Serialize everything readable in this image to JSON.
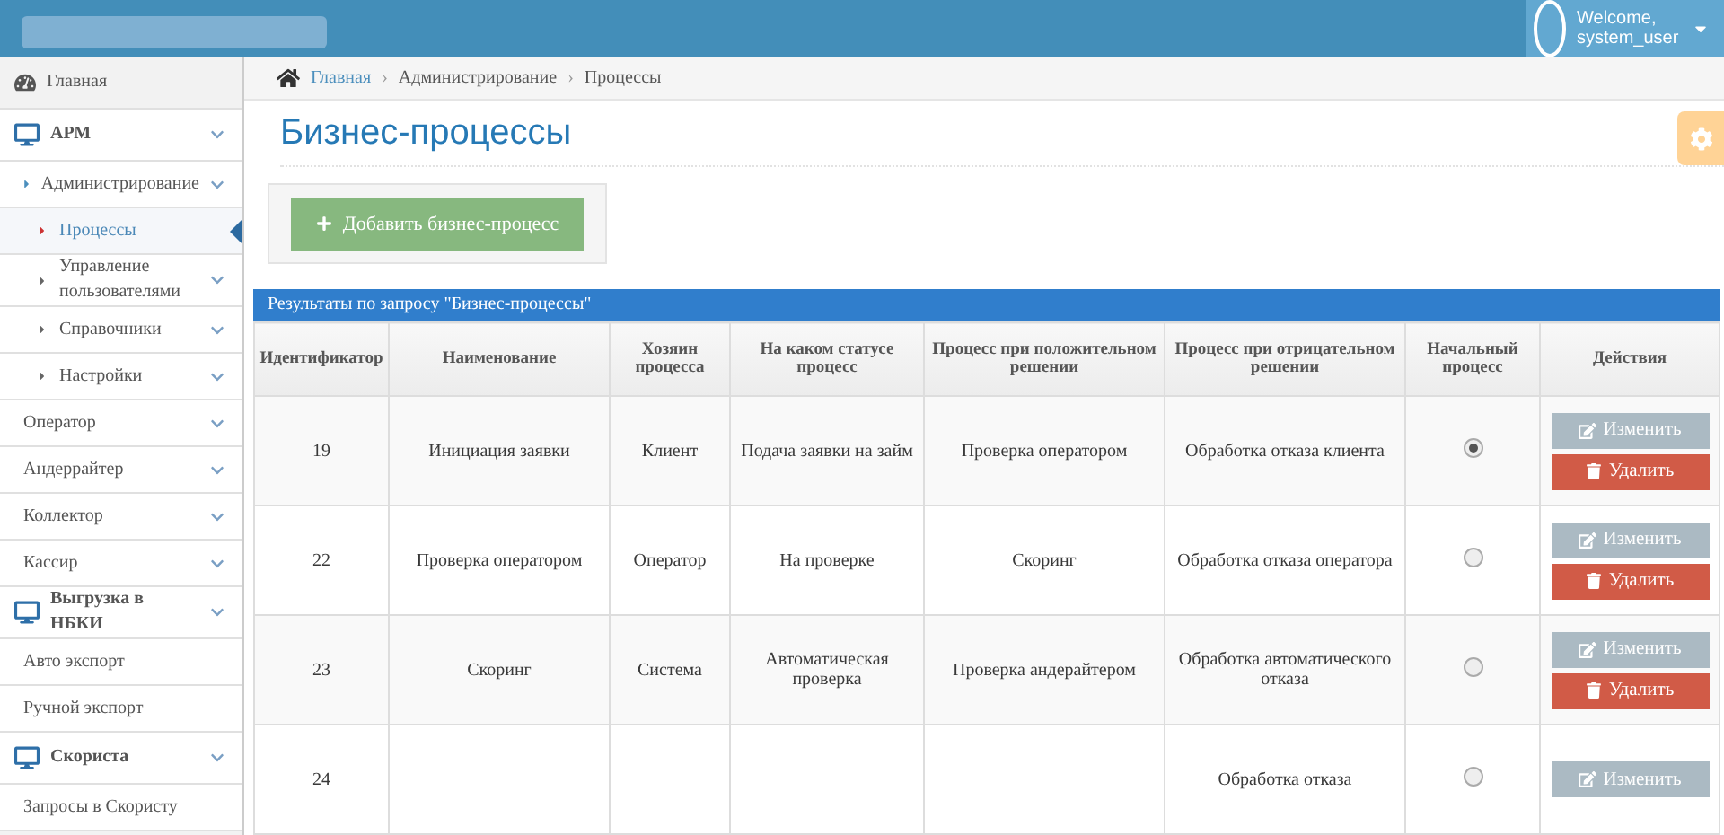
{
  "topbar": {
    "welcome": "Welcome,",
    "user": "system_user"
  },
  "sidebar": {
    "items": [
      {
        "label": "Главная",
        "kind": "home",
        "submenu": false,
        "selected": false
      },
      {
        "label": "АРМ",
        "kind": "section",
        "submenu": true,
        "selected": false,
        "children": [
          {
            "label": "Администрирование",
            "submenu": true,
            "selected": false,
            "children": [
              {
                "label": "Процессы",
                "submenu": false,
                "selected": true
              },
              {
                "label": "Управление пользователями",
                "submenu": true,
                "selected": false
              },
              {
                "label": "Справочники",
                "submenu": true,
                "selected": false
              },
              {
                "label": "Настройки",
                "submenu": true,
                "selected": false
              }
            ]
          },
          {
            "label": "Оператор",
            "submenu": true,
            "selected": false
          },
          {
            "label": "Андеррайтер",
            "submenu": true,
            "selected": false
          },
          {
            "label": "Коллектор",
            "submenu": true,
            "selected": false
          },
          {
            "label": "Кассир",
            "submenu": true,
            "selected": false
          }
        ]
      },
      {
        "label": "Выгрузка в НБКИ",
        "kind": "section",
        "submenu": true,
        "selected": false,
        "children": [
          {
            "label": "Авто экспорт",
            "submenu": false,
            "selected": false
          },
          {
            "label": "Ручной экспорт",
            "submenu": false,
            "selected": false
          }
        ]
      },
      {
        "label": "Скориста",
        "kind": "section",
        "submenu": true,
        "selected": false,
        "children": [
          {
            "label": "Запросы в Скористу",
            "submenu": false,
            "selected": false
          }
        ]
      }
    ]
  },
  "breadcrumb": [
    "Главная",
    "Администрирование",
    "Процессы"
  ],
  "breadcrumb_separator": "›",
  "page_title": "Бизнес-процессы",
  "add_button": "Добавить бизнес-процесс",
  "table": {
    "caption": "Результаты по запросу \"Бизнес-процессы\"",
    "columns": [
      "Идентификатор",
      "Наименование",
      "Хозяин процесса",
      "На каком статусе процесс",
      "Процесс при положительном решении",
      "Процесс при отрицательном решении",
      "Начальный процесс",
      "Действия"
    ],
    "rows": [
      {
        "id": "19",
        "name": "Инициация заявки",
        "owner": "Клиент",
        "status": "Подача заявки на займ",
        "positive": "Проверка оператором",
        "negative": "Обработка отказа клиента",
        "initial": true,
        "edit": "Изменить",
        "delete": "Удалить"
      },
      {
        "id": "22",
        "name": "Проверка оператором",
        "owner": "Оператор",
        "status": "На проверке",
        "positive": "Скоринг",
        "negative": "Обработка отказа оператора",
        "initial": false,
        "edit": "Изменить",
        "delete": "Удалить"
      },
      {
        "id": "23",
        "name": "Скоринг",
        "owner": "Система",
        "status": "Автоматическая проверка",
        "positive": "Проверка андерайтером",
        "negative": "Обработка автоматического отказа",
        "initial": false,
        "edit": "Изменить",
        "delete": "Удалить"
      },
      {
        "id": "24",
        "negative": "Обработка отказа",
        "initial": false,
        "edit": "Изменить"
      }
    ]
  }
}
